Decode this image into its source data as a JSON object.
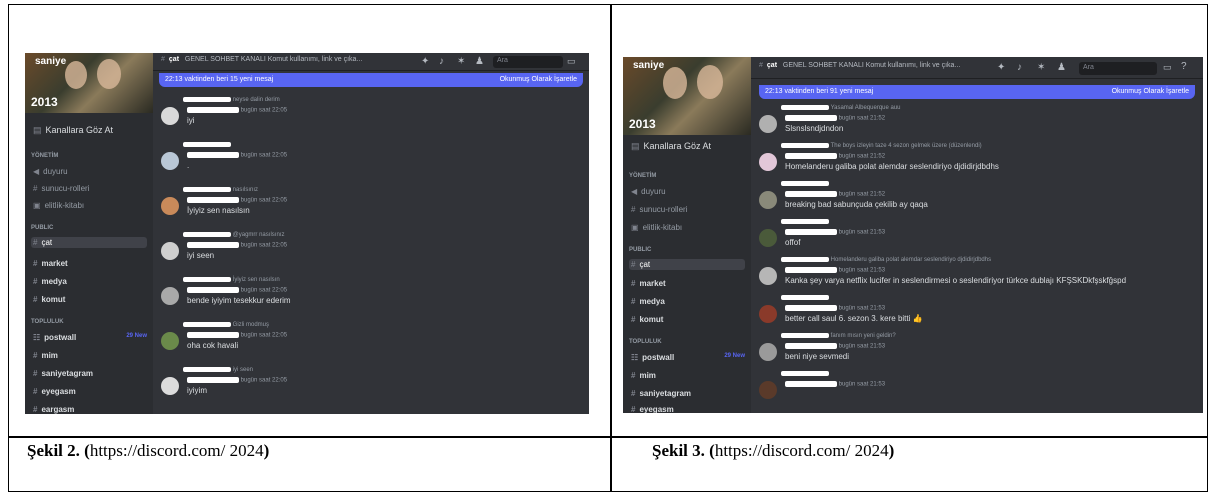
{
  "captions": [
    {
      "fig": "Şekil 2. (",
      "src": "https://discord.com/ 2024",
      "end": ")"
    },
    {
      "fig": "Şekil 3. (",
      "src": "https://discord.com/ 2024",
      "end": ")"
    }
  ],
  "left": {
    "banner_name": "saniye",
    "banner_year": "2013",
    "browse": "Kanallara Göz At",
    "cat_admin": "YÖNETİM",
    "ch_duyuru": "duyuru",
    "ch_roles": "sunucu-rolleri",
    "ch_book": "elitlik-kitabı",
    "cat_public": "PUBLIC",
    "ch_cat": "çat",
    "ch_market": "market",
    "ch_medya": "medya",
    "ch_komut": "komut",
    "cat_topluluk": "TOPLULUK",
    "ch_postwall": "postwall",
    "postwall_new": "29 New",
    "ch_mim": "mim",
    "ch_saniyetagram": "saniyetagram",
    "ch_eyegasm": "eyegasm",
    "ch_eargasm": "eargasm",
    "top_channel": "çat",
    "top_desc": "GENEL SOHBET KANALI Komut kullanımı, link ve çıka...",
    "search": "Ara",
    "new_msgs": "22:13 vaktinden beri 15 yeni mesaj",
    "mark_read": "Okunmuş Olarak İşaretle",
    "messages": [
      {
        "reply": "neyse dalin derim",
        "time": "bugün saat 22:05",
        "text": "iyi"
      },
      {
        "reply": "",
        "time": "bugün saat 22:05",
        "text": "."
      },
      {
        "reply": "nasılsınız",
        "time": "bugün saat 22:05",
        "text": "İyiyiz sen nasılsın"
      },
      {
        "reply": "@yagmrr nasılsınız",
        "time": "bugün saat 22:05",
        "text": "iyi seen"
      },
      {
        "reply": "İyiyiz sen nasılsın",
        "time": "bugün saat 22:05",
        "text": "bende iyiyim tesekkur ederim"
      },
      {
        "reply": "Gizli modmuş",
        "time": "bugün saat 22:05",
        "text": "oha cok havali"
      },
      {
        "reply": "iyi seen",
        "time": "bugün saat 22:05",
        "text": "iyiyim"
      }
    ]
  },
  "right": {
    "banner_name": "saniye",
    "banner_year": "2013",
    "browse": "Kanallara Göz At",
    "cat_admin": "YÖNETİM",
    "ch_duyuru": "duyuru",
    "ch_roles": "sunucu-rolleri",
    "ch_book": "elitlik-kitabı",
    "cat_public": "PUBLIC",
    "ch_cat": "çat",
    "ch_market": "market",
    "ch_medya": "medya",
    "ch_komut": "komut",
    "cat_topluluk": "TOPLULUK",
    "ch_postwall": "postwall",
    "postwall_new": "29 New",
    "ch_mim": "mim",
    "ch_saniyetagram": "saniyetagram",
    "ch_eyegasm": "eyegasm",
    "top_channel": "çat",
    "top_desc": "GENEL SOHBET KANALI Komut kullanımı, link ve çıka...",
    "search": "Ara",
    "new_msgs": "22:13 vaktinden beri 91 yeni mesaj",
    "mark_read": "Okunmuş Olarak İşaretle",
    "messages": [
      {
        "reply": "Yasamal Albequerque auu",
        "time": "bugün saat 21:52",
        "text": "Slsnslsndjdndon"
      },
      {
        "reply": "The boys izleyin taze 4 sezon gelmek üzere (düzenlendi)",
        "time": "bugün saat 21:52",
        "text": "Homelanderu galiba polat alemdar seslendiriyo djdidirjdbdhs"
      },
      {
        "reply": "",
        "time": "bugün saat 21:52",
        "text": "breaking bad sabunçuda çekilib ay qaqa"
      },
      {
        "reply": "",
        "time": "bugün saat 21:53",
        "text": "offof"
      },
      {
        "reply": "Homelanderu galiba polat alemdar seslendiriyo djdidirjdbdhs",
        "time": "bugün saat 21:53",
        "text": "Kanka şey varya netflix lucifer in seslendirmesi o seslendiriyor türkce dublajı KFŞSKDkfşskfğspd"
      },
      {
        "reply": "",
        "time": "bugün saat 21:53",
        "text": "better call saul 6. sezon 3. kere bitti 👍"
      },
      {
        "reply": "fanım mısın yeni geldin?",
        "time": "bugün saat 21:53",
        "text": "beni niye sevmedi"
      },
      {
        "reply": "",
        "time": "bugün saat 21:53",
        "text": ""
      }
    ]
  }
}
